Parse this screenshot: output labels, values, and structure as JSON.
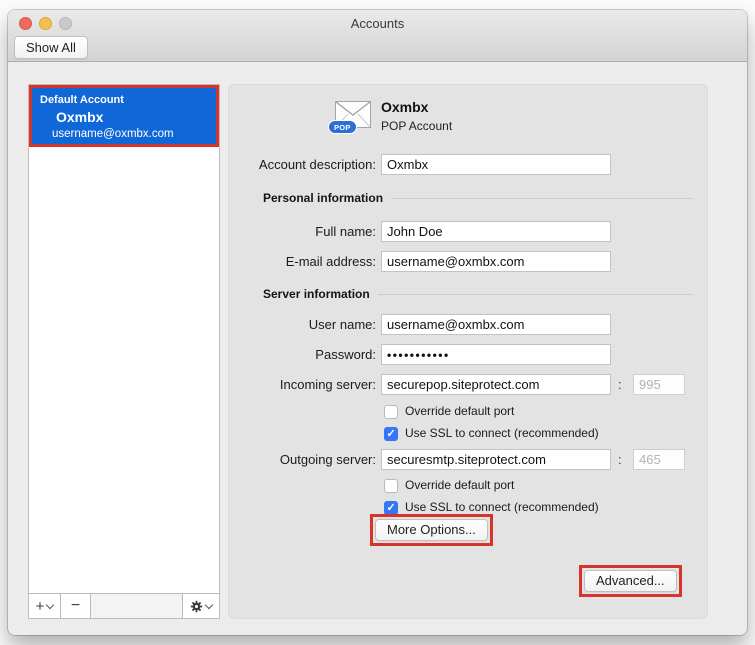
{
  "window": {
    "title": "Accounts",
    "show_all": "Show All"
  },
  "colors": {
    "selection_blue": "#1067d8",
    "annotation_red": "#d6352b",
    "checkbox_blue": "#3477f6",
    "pop_badge_blue": "#2e6fd6"
  },
  "sidebar": {
    "account": {
      "badge": "Default Account",
      "name": "Oxmbx",
      "email": "username@oxmbx.com"
    },
    "toolbar": {
      "add": "+",
      "remove": "−"
    }
  },
  "account_header": {
    "name": "Oxmbx",
    "type": "POP Account",
    "badge": "POP"
  },
  "form": {
    "account_description": {
      "label": "Account description:",
      "value": "Oxmbx"
    },
    "sections": {
      "personal": "Personal information",
      "server": "Server information"
    },
    "full_name": {
      "label": "Full name:",
      "value": "John Doe"
    },
    "email_address": {
      "label": "E-mail address:",
      "value": "username@oxmbx.com"
    },
    "user_name": {
      "label": "User name:",
      "value": "username@oxmbx.com"
    },
    "password": {
      "label": "Password:",
      "value": "•••••••••••"
    },
    "incoming": {
      "label": "Incoming server:",
      "value": "securepop.siteprotect.com",
      "port": "995",
      "override_checked": false,
      "ssl_checked": true
    },
    "outgoing": {
      "label": "Outgoing server:",
      "value": "securesmtp.siteprotect.com",
      "port": "465",
      "override_checked": false,
      "ssl_checked": true
    },
    "colon": ":",
    "override_label": "Override default port",
    "ssl_label": "Use SSL to connect (recommended)",
    "more_options": "More Options...",
    "advanced": "Advanced..."
  }
}
